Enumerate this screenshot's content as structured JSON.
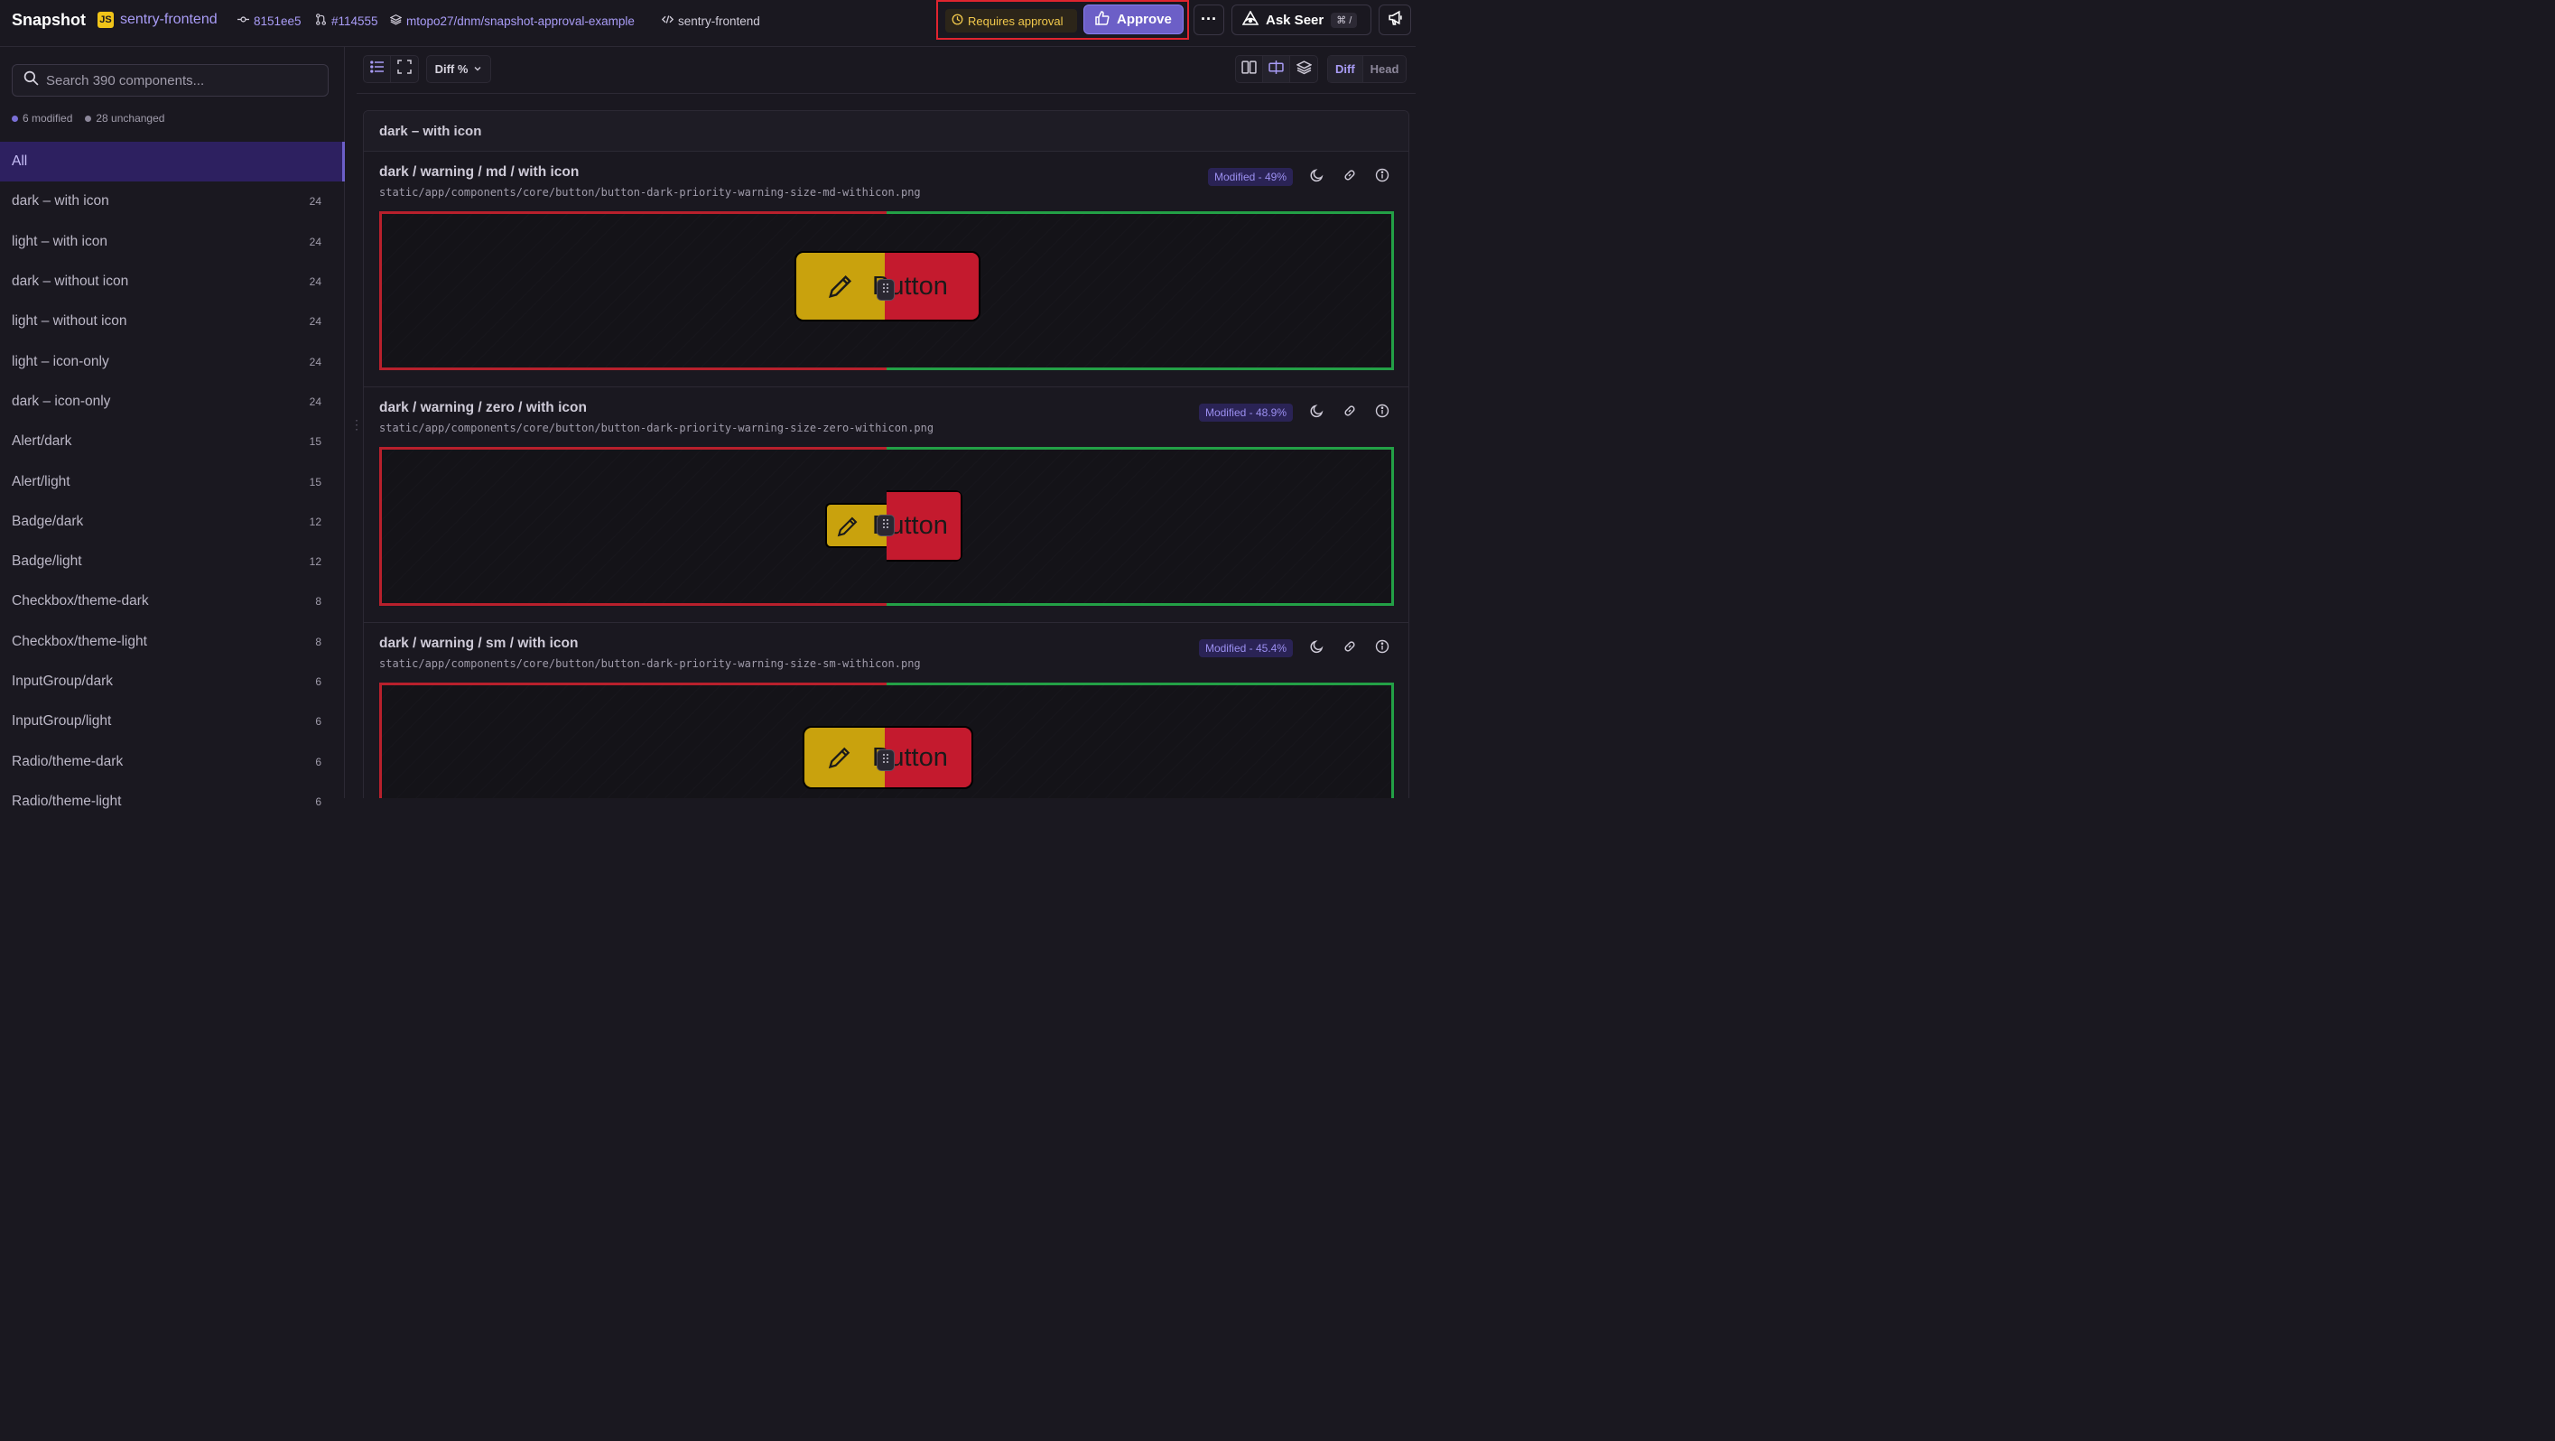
{
  "header": {
    "app_title": "Snapshot",
    "project_badge": "JS",
    "project_name": "sentry-frontend",
    "commit": "8151ee5",
    "pr": "#114555",
    "branch": "mtopo27/dnm/snapshot-approval-example",
    "app_id": "sentry-frontend",
    "requires_approval": "Requires approval",
    "approve_label": "Approve",
    "more_label": "···",
    "ask_seer_label": "Ask Seer",
    "ask_seer_shortcut": "⌘ /"
  },
  "sidebar": {
    "search_placeholder": "Search 390 components...",
    "modified_count": "6 modified",
    "unchanged_count": "28 unchanged",
    "items": [
      {
        "label": "All",
        "count": ""
      },
      {
        "label": "dark – with icon",
        "count": "24"
      },
      {
        "label": "light – with icon",
        "count": "24"
      },
      {
        "label": "dark – without icon",
        "count": "24"
      },
      {
        "label": "light – without icon",
        "count": "24"
      },
      {
        "label": "light – icon-only",
        "count": "24"
      },
      {
        "label": "dark – icon-only",
        "count": "24"
      },
      {
        "label": "Alert/dark",
        "count": "15"
      },
      {
        "label": "Alert/light",
        "count": "15"
      },
      {
        "label": "Badge/dark",
        "count": "12"
      },
      {
        "label": "Badge/light",
        "count": "12"
      },
      {
        "label": "Checkbox/theme-dark",
        "count": "8"
      },
      {
        "label": "Checkbox/theme-light",
        "count": "8"
      },
      {
        "label": "InputGroup/dark",
        "count": "6"
      },
      {
        "label": "InputGroup/light",
        "count": "6"
      },
      {
        "label": "Radio/theme-dark",
        "count": "6"
      },
      {
        "label": "Radio/theme-light",
        "count": "6"
      }
    ]
  },
  "toolbar": {
    "diff_select": "Diff %",
    "view_diff": "Diff",
    "view_head": "Head"
  },
  "main": {
    "group_title": "dark – with icon",
    "snapshots": [
      {
        "title": "dark / warning / md / with icon",
        "path": "static/app/components/core/button/button-dark-priority-warning-size-md-withicon.png",
        "badge": "Modified - 49%",
        "button_text": "Button"
      },
      {
        "title": "dark / warning / zero / with icon",
        "path": "static/app/components/core/button/button-dark-priority-warning-size-zero-withicon.png",
        "badge": "Modified - 48.9%",
        "button_text": "Button"
      },
      {
        "title": "dark / warning / sm / with icon",
        "path": "static/app/components/core/button/button-dark-priority-warning-size-sm-withicon.png",
        "badge": "Modified - 45.4%",
        "button_text": "Button"
      }
    ]
  },
  "colors": {
    "accent": "#6c5fc7",
    "base_border": "#b8202c",
    "head_border": "#23a046",
    "warning_yellow": "#c9a20d",
    "danger_red": "#c41a2e",
    "approval_highlight": "#e0242f"
  }
}
